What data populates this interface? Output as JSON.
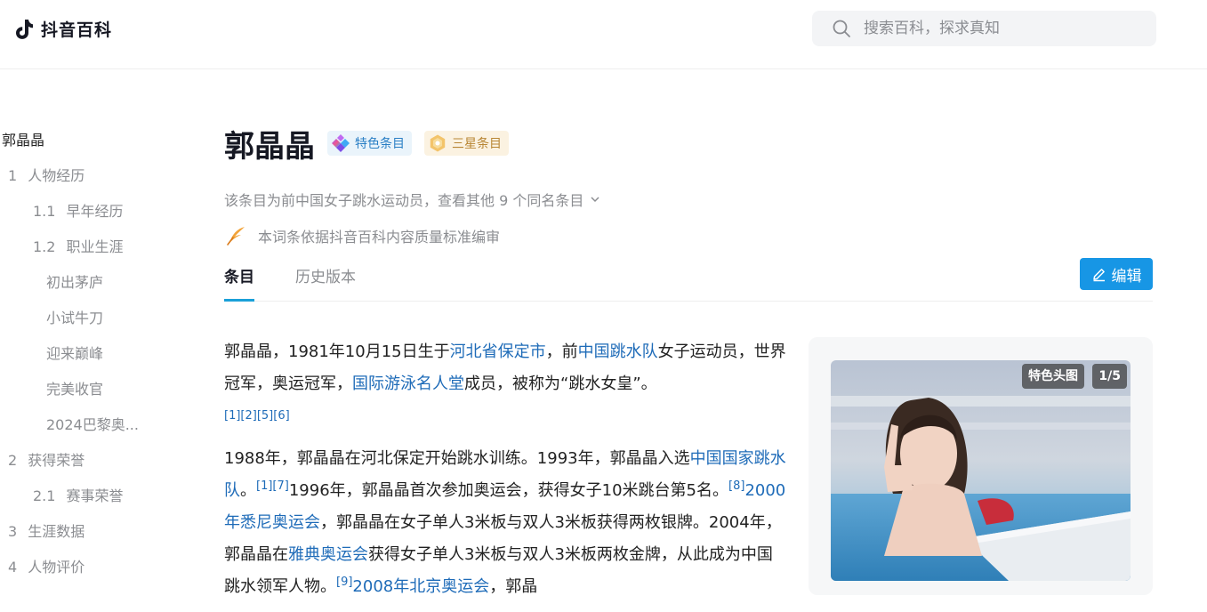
{
  "header": {
    "brand": "抖音百科",
    "search_placeholder": "搜索百科，探求真知"
  },
  "toc": {
    "root": "郭晶晶",
    "items": [
      {
        "num": "1",
        "label": "人物经历",
        "level": 1
      },
      {
        "num": "1.1",
        "label": "早年经历",
        "level": 2
      },
      {
        "num": "1.2",
        "label": "职业生涯",
        "level": 2
      },
      {
        "num": "",
        "label": "初出茅庐",
        "level": 3
      },
      {
        "num": "",
        "label": "小试牛刀",
        "level": 3
      },
      {
        "num": "",
        "label": "迎来巅峰",
        "level": 3
      },
      {
        "num": "",
        "label": "完美收官",
        "level": 3
      },
      {
        "num": "",
        "label": "2024巴黎奥...",
        "level": 3
      },
      {
        "num": "2",
        "label": "获得荣誉",
        "level": 1
      },
      {
        "num": "2.1",
        "label": "赛事荣誉",
        "level": 2
      },
      {
        "num": "3",
        "label": "生涯数据",
        "level": 1
      },
      {
        "num": "4",
        "label": "人物评价",
        "level": 1
      }
    ]
  },
  "article": {
    "title": "郭晶晶",
    "badge_featured": "特色条目",
    "badge_star": "三星条目",
    "subtitle": "该条目为前中国女子跳水运动员，查看其他 9 个同名条目",
    "quality_note": "本词条依据抖音百科内容质量标准编审",
    "tab_active": "条目",
    "tab_history": "历史版本",
    "edit_label": "编辑",
    "p1": {
      "t1": "郭晶晶，1981年10月15日生于",
      "l1": "河北省保定市",
      "t2": "，前",
      "l2": "中国跳水队",
      "t3": "女子运动员，世界冠军，奥运冠军，",
      "l3": "国际游泳名人堂",
      "t4": "成员，被称为“跳水女皇”。",
      "refs": "[1][2][5][6]"
    },
    "p2": {
      "t1": "1988年，郭晶晶在河北保定开始跳水训练。1993年，郭晶晶入选",
      "l1": "中国国家跳水队",
      "t2": "。",
      "r1": "[1][7]",
      "t3": "1996年，郭晶晶首次参加奥运会，获得女子10米跳台第5名。",
      "r2": "[8]",
      "l2": "2000年悉尼奥运会",
      "t4": "，郭晶晶在女子单人3米板与双人3米板获得两枚银牌。2004年，郭晶晶在",
      "l3": "雅典奥运会",
      "t5": "获得女子单人3米板与双人3米板两枚金牌，从此成为中国跳水领军人物。",
      "r3": "[9]",
      "l4": "2008年北京奥运会",
      "t6": "，郭晶"
    }
  },
  "infobox": {
    "tag_featured": "特色头图",
    "tag_count": "1/5"
  },
  "colors": {
    "accent": "#1796e5",
    "link": "#1e6bb8",
    "tab_underline": "#1aa0d8"
  }
}
